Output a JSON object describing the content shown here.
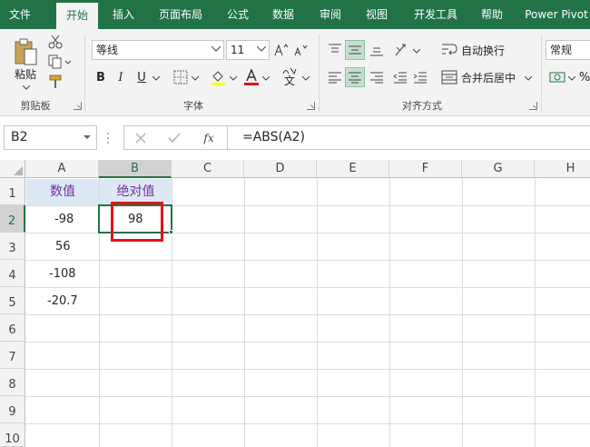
{
  "ribbon_tabs": [
    {
      "label": "文件"
    },
    {
      "label": "开始"
    },
    {
      "label": "插入"
    },
    {
      "label": "页面布局"
    },
    {
      "label": "公式"
    },
    {
      "label": "数据"
    },
    {
      "label": "审阅"
    },
    {
      "label": "视图"
    },
    {
      "label": "开发工具"
    },
    {
      "label": "帮助"
    },
    {
      "label": "Power Pivot"
    }
  ],
  "ribbon": {
    "clipboard": {
      "paste_label": "粘贴",
      "group_label": "剪贴板"
    },
    "font": {
      "font_name": "等线",
      "font_size": "11",
      "bold": "B",
      "italic": "I",
      "underline": "U",
      "group_label": "字体",
      "phonetic_char": "文"
    },
    "alignment": {
      "wrap_text": "自动换行",
      "merge_center": "合并后居中",
      "group_label": "对齐方式"
    },
    "number": {
      "format": "常规",
      "percent": "%"
    }
  },
  "formula_bar": {
    "name_box": "B2",
    "fx": "fx",
    "formula": "=ABS(A2)"
  },
  "sheet": {
    "columns": [
      "A",
      "B",
      "C",
      "D",
      "E",
      "F",
      "G",
      "H"
    ],
    "rows": [
      "1",
      "2",
      "3",
      "4",
      "5",
      "6",
      "7",
      "8",
      "9",
      "10"
    ],
    "header_a": "数值",
    "header_b": "绝对值",
    "values_a": [
      "-98",
      "56",
      "-108",
      "-20.7"
    ],
    "value_b2": "98"
  },
  "colors": {
    "ribbon_green": "#217346",
    "header_fill": "#dde8f5",
    "header_text": "#7030a0",
    "highlight_box": "#e0141b"
  }
}
